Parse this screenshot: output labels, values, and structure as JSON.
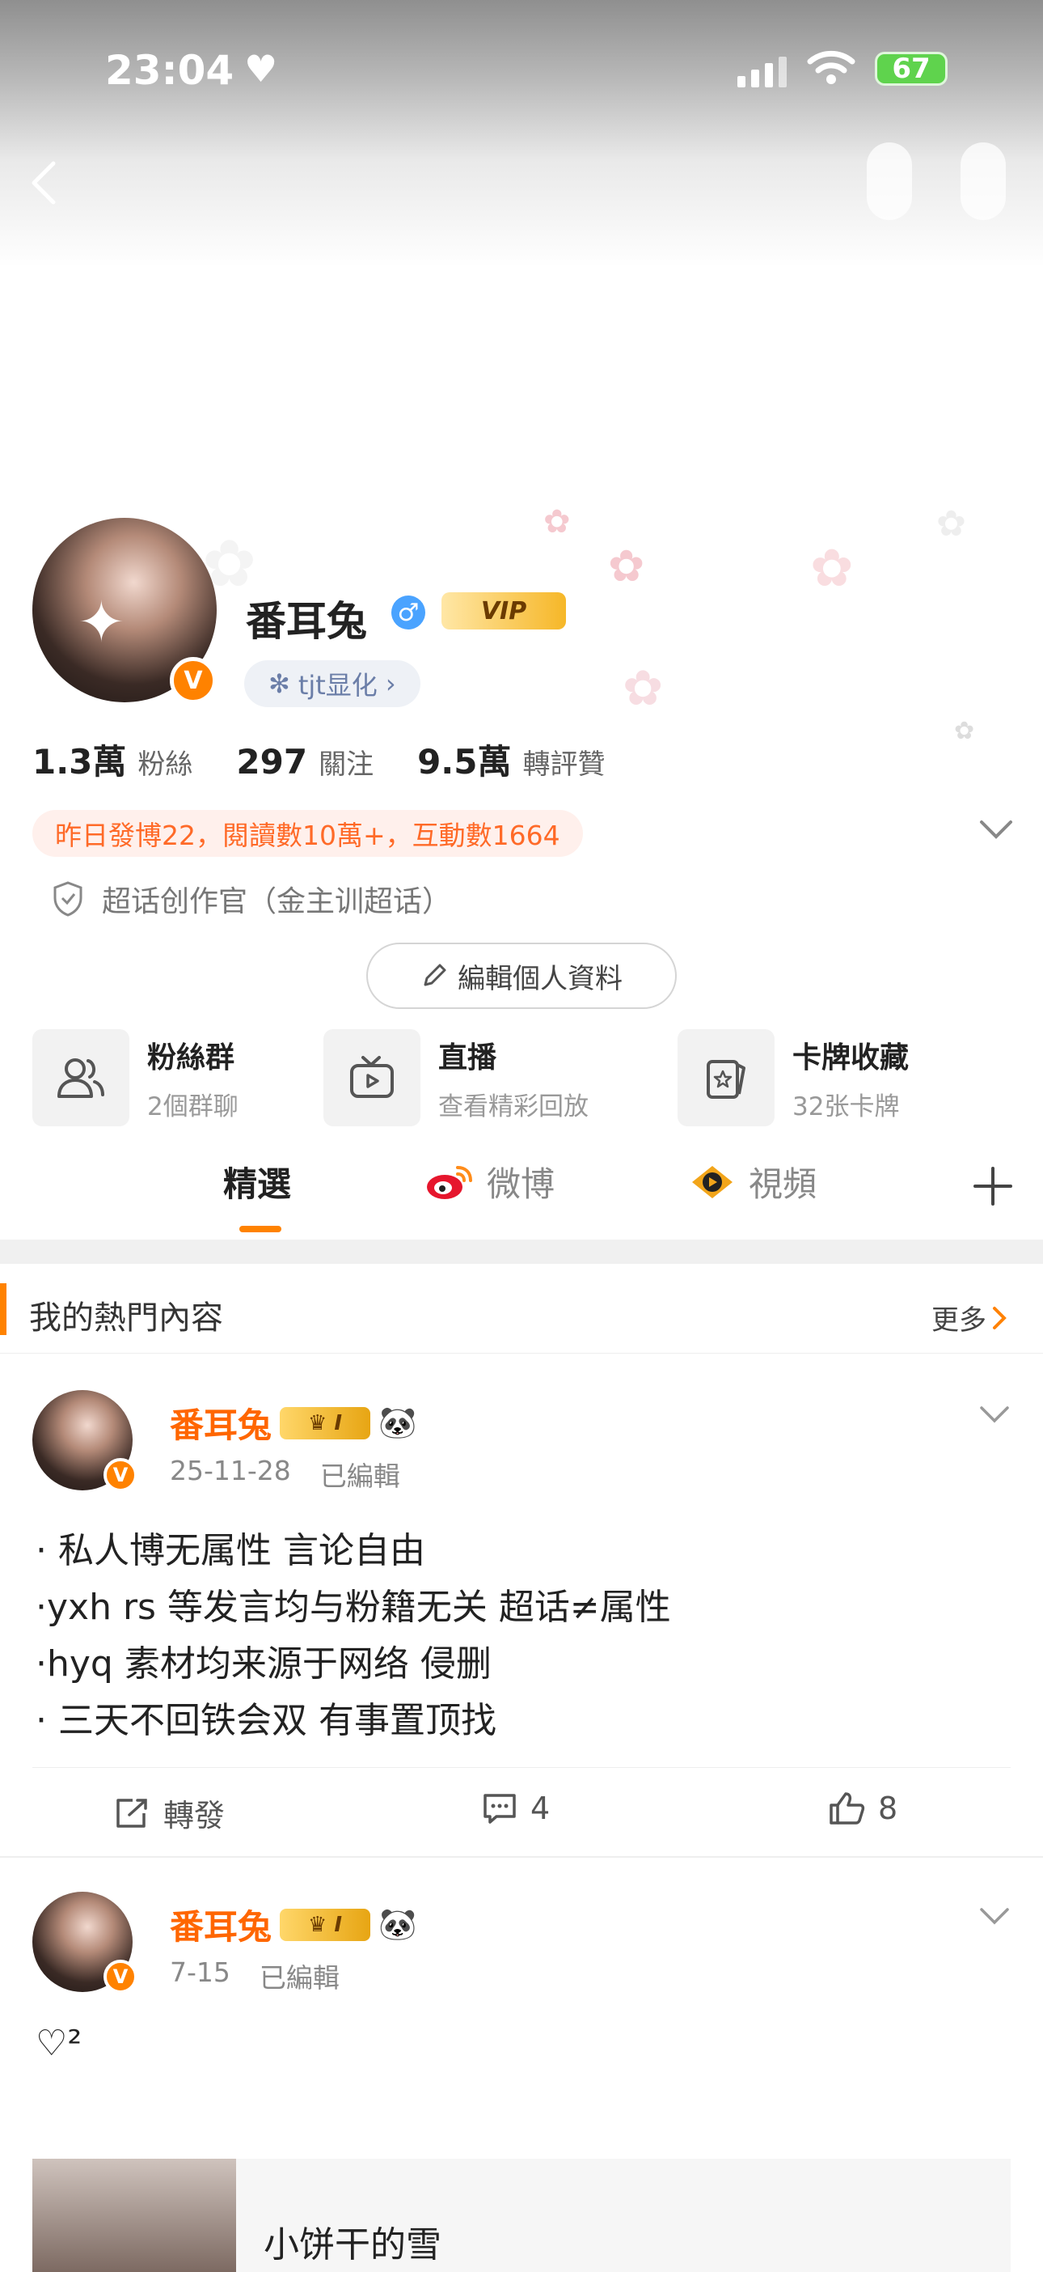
{
  "status_bar": {
    "time": "23:04",
    "battery": "67"
  },
  "profile": {
    "name": "番耳兔",
    "verified_badge": "V",
    "gender_symbol": "♂",
    "vip_label": "VIP",
    "tag_label": "tjt显化",
    "stats": [
      {
        "value": "1.3萬",
        "label": "粉絲"
      },
      {
        "value": "297",
        "label": "關注"
      },
      {
        "value": "9.5萬",
        "label": "轉評贊"
      }
    ],
    "activity": "昨日發博22，閱讀數10萬+，互動數1664",
    "super_role": "超话创作官（金主训超话）",
    "edit_button": "編輯個人資料"
  },
  "features": [
    {
      "title": "粉絲群",
      "subtitle": "2個群聊",
      "icon": "people-icon"
    },
    {
      "title": "直播",
      "subtitle": "查看精彩回放",
      "icon": "tv-icon"
    },
    {
      "title": "卡牌收藏",
      "subtitle": "32张卡牌",
      "icon": "card-icon"
    }
  ],
  "tabs": [
    {
      "label": "精選",
      "active": true
    },
    {
      "label": "微博",
      "active": false
    },
    {
      "label": "視頻",
      "active": false
    }
  ],
  "hot_section": {
    "title": "我的熱門內容",
    "more": "更多"
  },
  "posts": [
    {
      "author": "番耳兔",
      "level_badge": "I",
      "date": "25-11-28",
      "edited": "已編輯",
      "lines": [
        "· 私人博无属性 言论自由",
        "·yxh rs 等发言均与粉籍无关 超话≠属性",
        "·hyq 素材均来源于网络 侵删",
        "· 三天不回铁会双 有事置顶找"
      ],
      "actions": {
        "repost": "轉發",
        "comments": "4",
        "likes": "8"
      }
    },
    {
      "author": "番耳兔",
      "level_badge": "I",
      "date": "7-15",
      "edited": "已編輯",
      "text": "♡²",
      "shared_title": "小饼干的雪"
    }
  ],
  "colors": {
    "accent": "#ff8200",
    "name_orange": "#ff6600",
    "activity_text": "#ff6a28",
    "tag_text": "#6b7ea8"
  }
}
